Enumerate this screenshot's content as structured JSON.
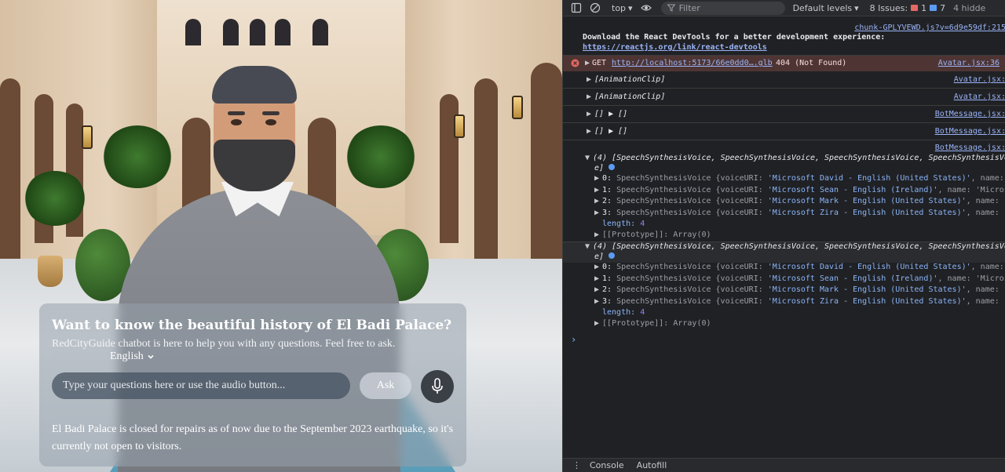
{
  "chat": {
    "title": "Want to know the beautiful history of El Badi Palace?",
    "subtitle": "RedCityGuide chatbot is here to help you with any questions. Feel free to ask.",
    "language": "English",
    "input_placeholder": "Type your questions here or use the audio button...",
    "ask_label": "Ask",
    "answer": "El Badi Palace is closed for repairs as of now due to the September 2023 earthquake, so it's currently not open to visitors."
  },
  "devtools": {
    "toolbar": {
      "context": "top",
      "filter_placeholder": "Filter",
      "levels": "Default levels",
      "issues_label": "8 Issues:",
      "issues_errors": "1",
      "issues_info": "7",
      "hidden": "4 hidde"
    },
    "console": {
      "src_top": "chunk-GPLYVEWD.js?v=6d9e59df:215",
      "download_msg": "Download the React DevTools for a better development experience:",
      "download_link": "https://reactjs.org/link/react-devtools",
      "error_method": "GET",
      "error_url": "http://localhost:5173/66e0dd0….glb",
      "error_status": "404 (Not Found)",
      "error_src": "Avatar.jsx:36",
      "anim1": "[AnimationClip]",
      "anim1_src": "Avatar.jsx:",
      "anim2": "[AnimationClip]",
      "anim2_src": "Avatar.jsx:",
      "arr1": "[] ▶ []",
      "arr1_src": "BotMessage.jsx:",
      "arr2": "[] ▶ []",
      "arr2_src": "BotMessage.jsx:",
      "group_src": "BotMessage.jsx:",
      "group_header": "(4) [SpeechSynthesisVoice, SpeechSynthesisVoice, SpeechSynthesisVoice, SpeechSynthesisVoic",
      "group_header_tail": "e]",
      "voices": [
        {
          "idx": "0:",
          "type": "SpeechSynthesisVoice {voiceURI: ",
          "uri": "'Microsoft David - English (United States)'",
          "rest": ", name: "
        },
        {
          "idx": "1:",
          "type": "SpeechSynthesisVoice {voiceURI: ",
          "uri": "'Microsoft Sean - English (Ireland)'",
          "rest": ", name: 'Micros"
        },
        {
          "idx": "2:",
          "type": "SpeechSynthesisVoice {voiceURI: ",
          "uri": "'Microsoft Mark - English (United States)'",
          "rest": ", name: '"
        },
        {
          "idx": "3:",
          "type": "SpeechSynthesisVoice {voiceURI: ",
          "uri": "'Microsoft Zira - English (United States)'",
          "rest": ", name: '"
        }
      ],
      "length_label": "length:",
      "length_value": "4",
      "prototype": "[[Prototype]]: Array(0)",
      "prompt": "›"
    },
    "tabs": {
      "console": "Console",
      "autofill": "Autofill"
    }
  },
  "colors": {
    "error_bg": "#4e3534",
    "link": "#9ab4f8",
    "string": "#8ab4f8",
    "number": "#9980ff"
  }
}
